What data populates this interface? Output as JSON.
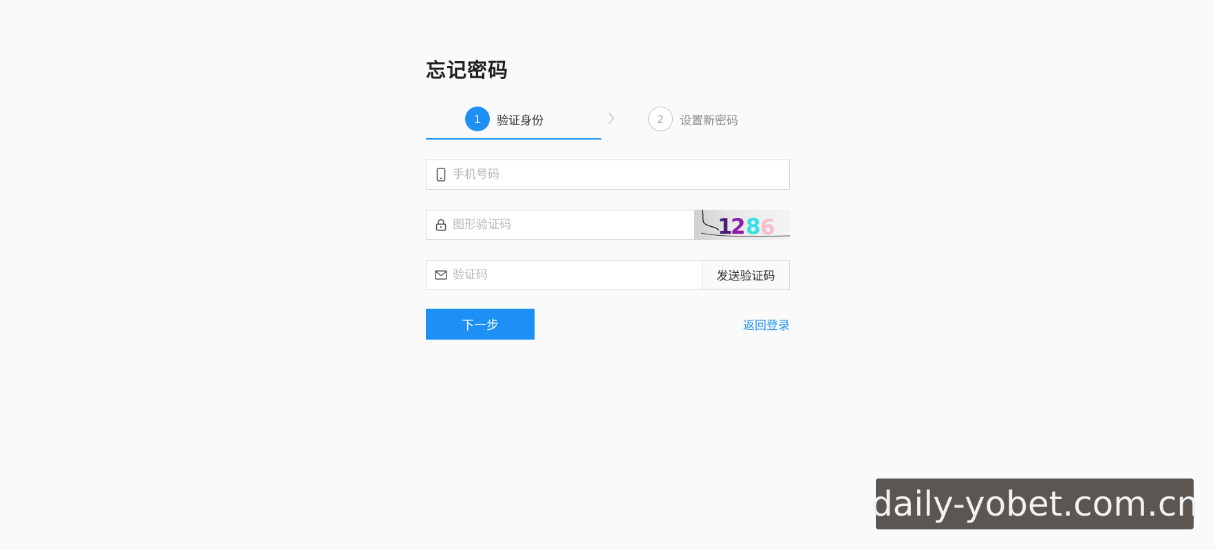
{
  "page": {
    "title": "忘记密码"
  },
  "steps": [
    {
      "number": "1",
      "label": "验证身份",
      "state": "active"
    },
    {
      "number": "2",
      "label": "设置新密码",
      "state": "pending"
    }
  ],
  "form": {
    "phone": {
      "placeholder": "手机号码",
      "value": "",
      "icon": "phone-icon"
    },
    "captcha": {
      "placeholder": "图形验证码",
      "value": "",
      "icon": "lock-icon",
      "image_text": "1286"
    },
    "sms_code": {
      "placeholder": "验证码",
      "value": "",
      "icon": "mail-icon",
      "send_label": "发送验证码"
    }
  },
  "actions": {
    "next_label": "下一步",
    "back_label": "返回登录"
  },
  "watermark": {
    "text": "daily-yobet.com.cn"
  },
  "colors": {
    "accent": "#1e90f5",
    "background": "#fafafa",
    "border": "#d9d9d9",
    "placeholder": "#b8b8b8"
  }
}
